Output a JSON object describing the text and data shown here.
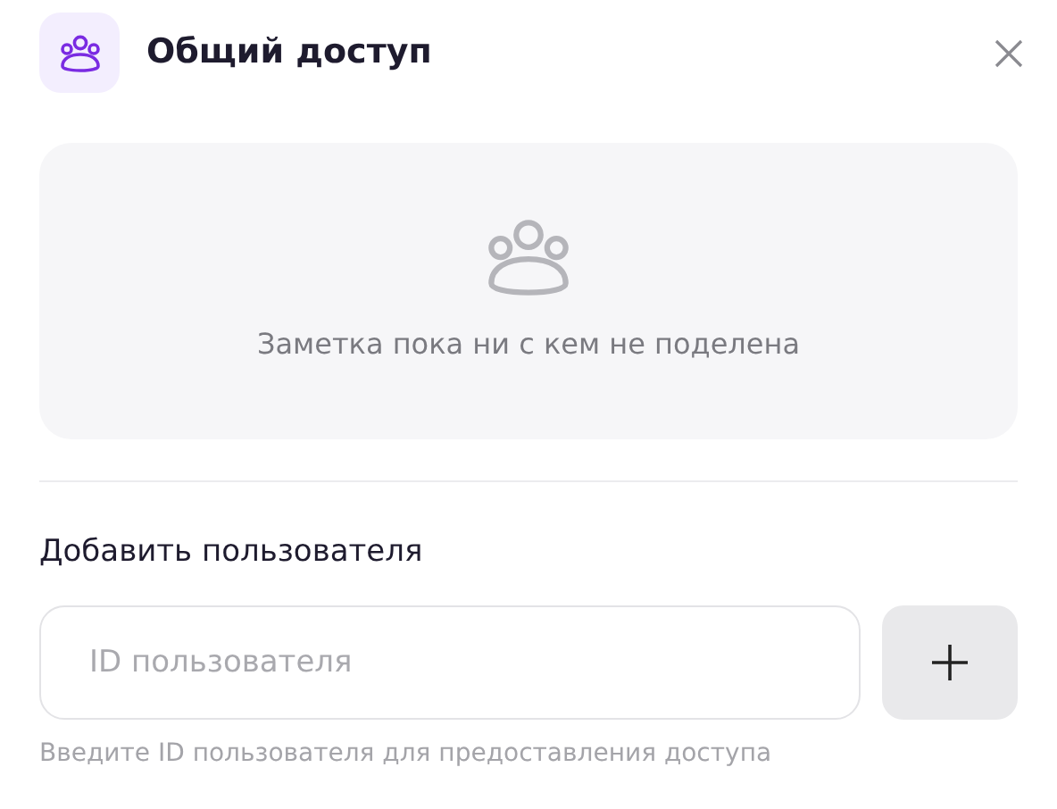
{
  "dialog": {
    "title": "Общий доступ"
  },
  "empty_state": {
    "message": "Заметка пока ни с кем не поделена"
  },
  "add_user": {
    "label": "Добавить пользователя",
    "input": {
      "placeholder": "ID пользователя"
    },
    "hint": "Введите ID пользователя для предоставления доступа"
  }
}
